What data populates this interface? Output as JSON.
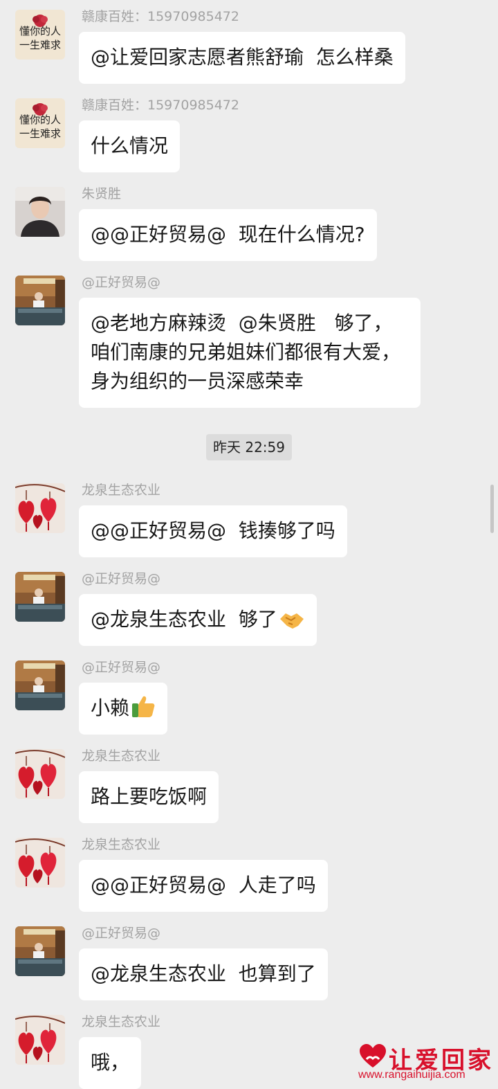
{
  "messages": [
    {
      "sender": "赣康百姓：15970985472",
      "avatar": "flower-text",
      "avatar_text": [
        "懂你的人",
        "一生难求"
      ],
      "text": "@让爱回家志愿者熊舒瑜  怎么样桑"
    },
    {
      "sender": "赣康百姓：15970985472",
      "avatar": "flower-text",
      "avatar_text": [
        "懂你的人",
        "一生难求"
      ],
      "text": "什么情况"
    },
    {
      "sender": "朱贤胜",
      "avatar": "person-photo",
      "text": "@@正好贸易@  现在什么情况?"
    },
    {
      "sender": "@正好贸易@",
      "avatar": "office-photo",
      "text": "@老地方麻辣烫  @朱贤胜   够了，咱们南康的兄弟姐妹们都很有大爱，身为组织的一员深感荣幸"
    },
    {
      "sender": "龙泉生态农业",
      "avatar": "hearts-photo",
      "text": "@@正好贸易@  钱揍够了吗"
    },
    {
      "sender": "@正好贸易@",
      "avatar": "office-photo",
      "text": "@龙泉生态农业  够了",
      "emoji": "handshake"
    },
    {
      "sender": "@正好贸易@",
      "avatar": "office-photo",
      "text": "小赖",
      "emoji": "thumbs-up"
    },
    {
      "sender": "龙泉生态农业",
      "avatar": "hearts-photo",
      "text": "路上要吃饭啊"
    },
    {
      "sender": "龙泉生态农业",
      "avatar": "hearts-photo",
      "text": "@@正好贸易@  人走了吗"
    },
    {
      "sender": "@正好贸易@",
      "avatar": "office-photo",
      "text": "@龙泉生态农业  也算到了"
    },
    {
      "sender": "龙泉生态农业",
      "avatar": "hearts-photo",
      "text": "哦，"
    }
  ],
  "timestamp": "昨天 22:59",
  "watermark": {
    "title": "让爱回家",
    "url": "www.rangaihuijia.com"
  },
  "colors": {
    "background": "#ededed",
    "bubble": "#ffffff",
    "sender": "#a3a3a3",
    "watermark": "#d8102b"
  }
}
